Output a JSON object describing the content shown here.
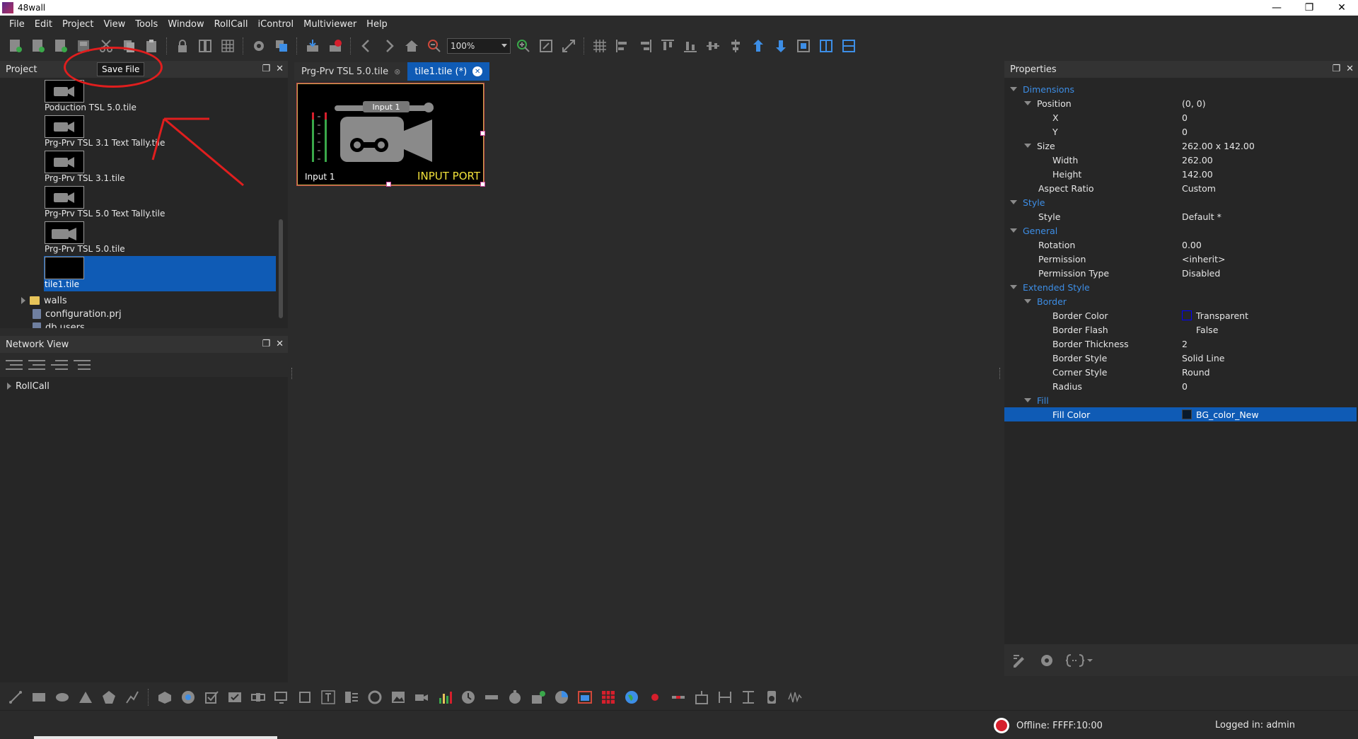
{
  "window": {
    "title": "48wall",
    "minimize": "—",
    "restore": "❐",
    "close": "✕"
  },
  "menu": [
    "File",
    "Edit",
    "Project",
    "View",
    "Tools",
    "Window",
    "RollCall",
    "iControl",
    "Multiviewer",
    "Help"
  ],
  "toolbar": {
    "zoom": "100%"
  },
  "tooltip": "Save File",
  "project_panel": {
    "title": "Project",
    "tiles": [
      "Poduction TSL 5.0.tile",
      "Prg-Prv TSL 3.1 Text Tally.tile",
      "Prg-Prv TSL 3.1.tile",
      "Prg-Prv TSL 5.0 Text Tally.tile",
      "Prg-Prv TSL 5.0.tile",
      "tile1.tile"
    ],
    "folders": [
      "walls"
    ],
    "files": [
      "configuration.prj",
      "db.users"
    ]
  },
  "network_panel": {
    "title": "Network View",
    "items": [
      "RollCall"
    ]
  },
  "editor": {
    "tabs": [
      {
        "label": "Prg-Prv TSL 5.0.tile",
        "active": false
      },
      {
        "label": "tile1.tile (*)",
        "active": true
      }
    ],
    "tile": {
      "input_top": "Input 1",
      "input_bottom": "Input 1",
      "port": "INPUT PORT"
    }
  },
  "properties": {
    "title": "Properties",
    "rows": [
      {
        "name": "Dimensions",
        "value": "",
        "type": "category",
        "indent": 0
      },
      {
        "name": "Position",
        "value": "(0, 0)",
        "type": "group",
        "indent": 1
      },
      {
        "name": "X",
        "value": "0",
        "type": "leaf",
        "indent": 2
      },
      {
        "name": "Y",
        "value": "0",
        "type": "leaf",
        "indent": 2
      },
      {
        "name": "Size",
        "value": "262.00 x 142.00",
        "type": "group",
        "indent": 1
      },
      {
        "name": "Width",
        "value": "262.00",
        "type": "leaf",
        "indent": 2
      },
      {
        "name": "Height",
        "value": "142.00",
        "type": "leaf",
        "indent": 2
      },
      {
        "name": "Aspect Ratio",
        "value": "Custom",
        "type": "leaf",
        "indent": 1
      },
      {
        "name": "Style",
        "value": "",
        "type": "category",
        "indent": 0
      },
      {
        "name": "Style",
        "value": "Default *",
        "type": "leaf",
        "indent": 1
      },
      {
        "name": "General",
        "value": "",
        "type": "category",
        "indent": 0
      },
      {
        "name": "Rotation",
        "value": "0.00",
        "type": "leaf",
        "indent": 1
      },
      {
        "name": "Permission",
        "value": "<inherit>",
        "type": "leaf",
        "indent": 1
      },
      {
        "name": "Permission Type",
        "value": "Disabled",
        "type": "leaf",
        "indent": 1
      },
      {
        "name": "Extended Style",
        "value": "",
        "type": "category",
        "indent": 0
      },
      {
        "name": "Border",
        "value": "",
        "type": "category",
        "indent": 1
      },
      {
        "name": "Border Color",
        "value": "Transparent",
        "type": "leaf",
        "indent": 2,
        "swatch": "transparent"
      },
      {
        "name": "Border Flash",
        "value": "False",
        "type": "leaf",
        "indent": 2,
        "swatch": "none"
      },
      {
        "name": "Border Thickness",
        "value": "2",
        "type": "leaf",
        "indent": 2
      },
      {
        "name": "Border Style",
        "value": "Solid Line",
        "type": "leaf",
        "indent": 2
      },
      {
        "name": "Corner Style",
        "value": "Round",
        "type": "leaf",
        "indent": 2
      },
      {
        "name": "Radius",
        "value": "0",
        "type": "leaf",
        "indent": 2
      },
      {
        "name": "Fill",
        "value": "",
        "type": "category",
        "indent": 1
      },
      {
        "name": "Fill Color",
        "value": "BG_color_New",
        "type": "leaf",
        "indent": 2,
        "swatch": "dark",
        "selected": true
      }
    ]
  },
  "status": {
    "offline": "Offline: FFFF:10:00",
    "login": "Logged in: admin"
  },
  "colors": {
    "accent": "#0f5bb5",
    "category": "#3d8ee6",
    "annotation": "#e01e1e",
    "port": "#f1e13a"
  }
}
